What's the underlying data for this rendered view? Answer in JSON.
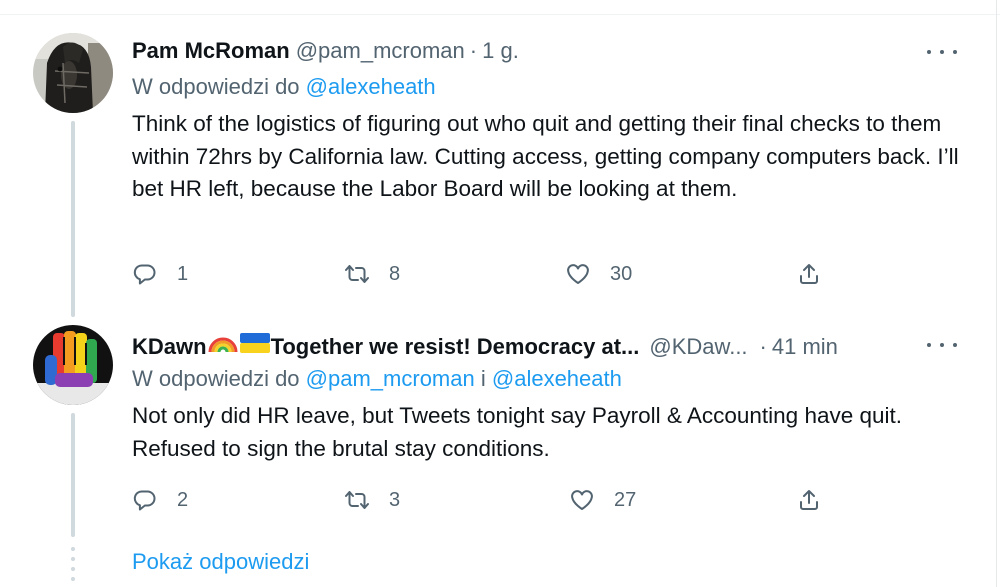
{
  "tweets": [
    {
      "author_name": "Pam McRoman",
      "handle": "@pam_mcroman",
      "separator": "·",
      "time": "1 g.",
      "reply_prefix": "W odpowiedzi do",
      "reply_mentions": [
        "@alexeheath"
      ],
      "reply_joiner": "",
      "text": "Think of the logistics of figuring out who quit and getting their final checks to them within 72hrs by California law. Cutting access, getting company computers back. I’ll bet HR left, because the Labor Board will be looking at them.",
      "replies": "1",
      "retweets": "8",
      "likes": "30"
    },
    {
      "author_name": "KDawn",
      "author_name_suffix": "Together we resist! Democracy at...",
      "handle": "@KDaw...",
      "separator": "·",
      "time": "41 min",
      "reply_prefix": "W odpowiedzi do",
      "reply_mentions": [
        "@pam_mcroman",
        "@alexeheath"
      ],
      "reply_joiner": "i",
      "text": "Not only did HR leave, but Tweets tonight say Payroll & Accounting have quit. Refused to sign the brutal stay conditions.",
      "replies": "2",
      "retweets": "3",
      "likes": "27"
    }
  ],
  "show_replies_label": "Pokaż odpowiedzi",
  "icons": {
    "reply": "reply-icon",
    "retweet": "retweet-icon",
    "like": "heart-icon",
    "share": "share-icon",
    "more": "more-icon"
  },
  "colors": {
    "text": "#0f1419",
    "secondary": "#536471",
    "accent": "#1d9bf0",
    "thread_line": "#cfd9de"
  }
}
